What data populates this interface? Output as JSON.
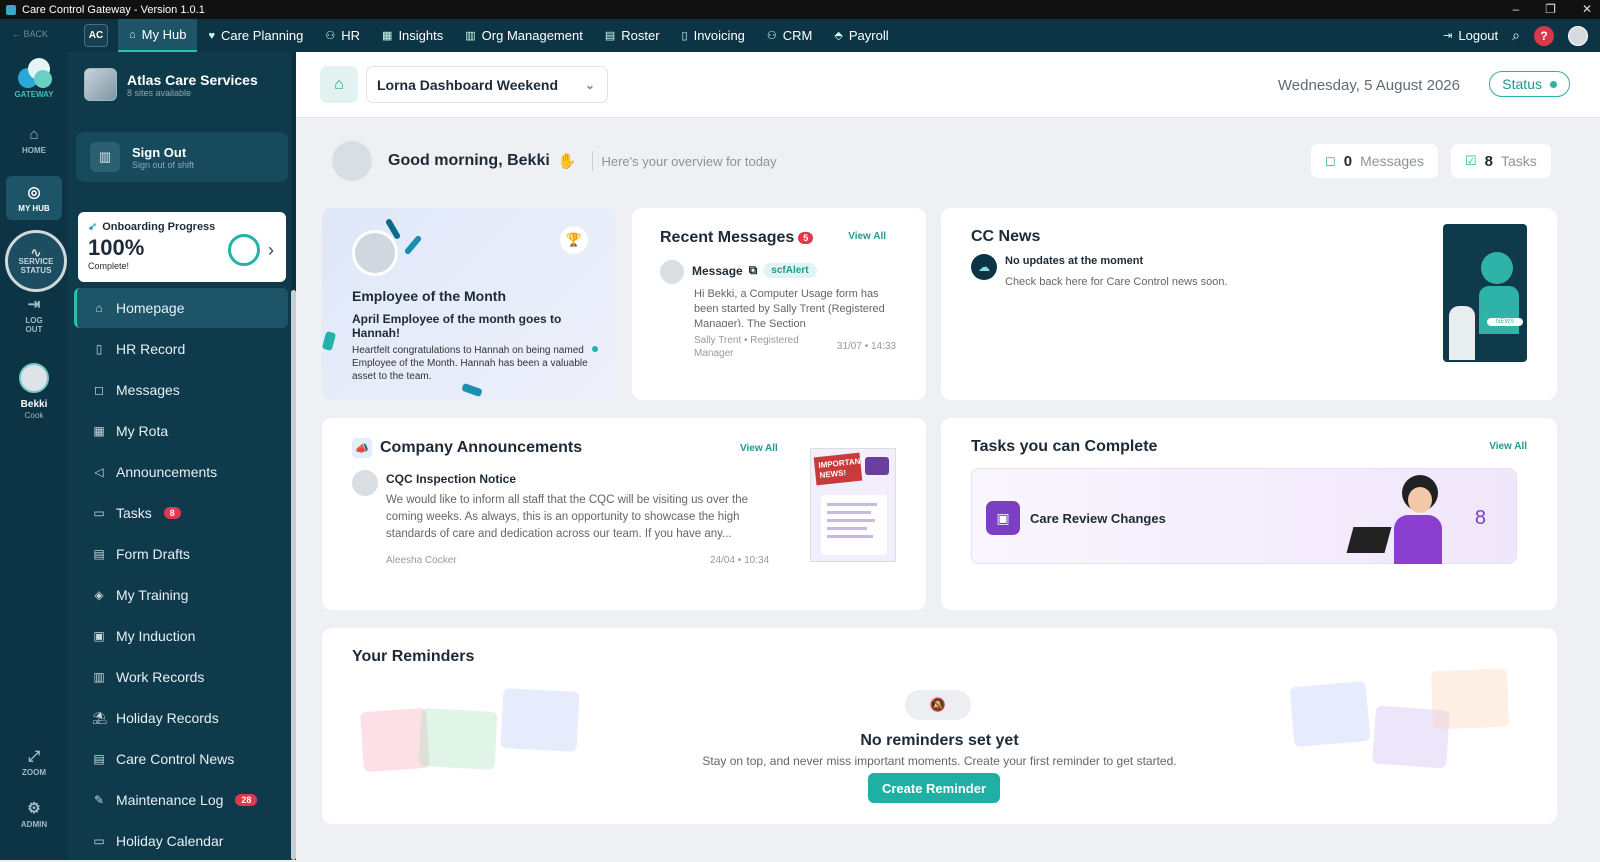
{
  "window": {
    "title": "Care Control Gateway - Version 1.0.1",
    "min": "–",
    "max": "❐",
    "close": "✕"
  },
  "topnav": {
    "back": "BACK",
    "ac": "AC",
    "items": [
      {
        "label": "My Hub",
        "icon": "⌂"
      },
      {
        "label": "Care Planning",
        "icon": "♥"
      },
      {
        "label": "HR",
        "icon": "⚇"
      },
      {
        "label": "Insights",
        "icon": "▦"
      },
      {
        "label": "Org Management",
        "icon": "▥"
      },
      {
        "label": "Roster",
        "icon": "▤"
      },
      {
        "label": "Invoicing",
        "icon": "▯"
      },
      {
        "label": "CRM",
        "icon": "⚇"
      },
      {
        "label": "Payroll",
        "icon": "⬘"
      }
    ],
    "logout": "Logout",
    "help": "?"
  },
  "rail": {
    "logo_text": "GATEWAY",
    "home": "HOME",
    "my_hub": "MY HUB",
    "service_status": "SERVICE STATUS",
    "log_out": "LOG OUT",
    "user_name": "Bekki",
    "user_role": "Cook",
    "zoom": "ZOOM",
    "admin": "ADMIN"
  },
  "sidebar": {
    "org_name": "Atlas Care Services",
    "org_sub": "8 sites available",
    "signout_title": "Sign Out",
    "signout_sub": "Sign out of shift",
    "onboarding": {
      "title": "Onboarding Progress",
      "percent": "100%",
      "sub": "Complete!",
      "progress": 1.0
    },
    "menu": [
      {
        "label": "Homepage",
        "icon": "⌂",
        "badge": ""
      },
      {
        "label": "HR Record",
        "icon": "▯",
        "badge": ""
      },
      {
        "label": "Messages",
        "icon": "◻",
        "badge": ""
      },
      {
        "label": "My Rota",
        "icon": "▦",
        "badge": ""
      },
      {
        "label": "Announcements",
        "icon": "◁",
        "badge": ""
      },
      {
        "label": "Tasks",
        "icon": "▭",
        "badge": "8"
      },
      {
        "label": "Form Drafts",
        "icon": "▤",
        "badge": ""
      },
      {
        "label": "My Training",
        "icon": "◈",
        "badge": ""
      },
      {
        "label": "My Induction",
        "icon": "▣",
        "badge": ""
      },
      {
        "label": "Work Records",
        "icon": "▥",
        "badge": ""
      },
      {
        "label": "Holiday Records",
        "icon": "⛱",
        "badge": ""
      },
      {
        "label": "Care Control News",
        "icon": "▤",
        "badge": ""
      },
      {
        "label": "Maintenance Log",
        "icon": "✎",
        "badge": "28"
      },
      {
        "label": "Holiday Calendar",
        "icon": "▭",
        "badge": ""
      }
    ]
  },
  "header": {
    "dashboard": "Lorna Dashboard Weekend",
    "date": "Wednesday, 5 August 2026",
    "status": "Status"
  },
  "greeting": {
    "text": "Good morning, Bekki",
    "sub": "Here's your overview for today",
    "messages_count": "0",
    "messages_label": "Messages",
    "tasks_count": "8",
    "tasks_label": "Tasks"
  },
  "employee": {
    "title": "Employee of the Month",
    "headline": "April Employee of the month goes to Hannah!",
    "body": "Heartfelt congratulations to Hannah on being named Employee of the Month. Hannah has been a valuable asset to the team."
  },
  "recent_messages": {
    "title": "Recent Messages",
    "badge": "5",
    "view_all": "View All",
    "msg_title": "Message",
    "tag": "scfAlert",
    "body": "Hi Bekki, a Computer Usage form has been started by Sally Trent (Registered Manager). The Section",
    "from": "Sally Trent • Registered Manager",
    "time": "31/07 • 14:33"
  },
  "cc_news": {
    "title": "CC News",
    "headline": "No updates at the moment",
    "sub": "Check back here for Care Control news soon.",
    "img_word": "NEWS"
  },
  "announcements": {
    "title": "Company Announcements",
    "view_all": "View All",
    "item_title": "CQC Inspection Notice",
    "body": "We would like to inform all staff that the CQC will be visiting us over the coming weeks. As always, this is an opportunity to showcase the high standards of care and dedication across our team. If you have any...",
    "author": "Aleesha Cocker",
    "time": "24/04 • 10:34",
    "img_text": "IMPORTANT NEWS!"
  },
  "tasks_card": {
    "title": "Tasks you can Complete",
    "view_all": "View All",
    "item": "Care Review Changes",
    "count": "8"
  },
  "reminders": {
    "title": "Your Reminders",
    "empty_title": "No reminders set yet",
    "empty_sub": "Stay on top, and never miss important moments. Create your first reminder to get started.",
    "button": "Create Reminder"
  },
  "colors": {
    "nav": "#0d3445",
    "sidebar": "#0f3a4b",
    "accent": "#1fb0a3",
    "badge": "#e2384d",
    "purple": "#7b3fc4"
  }
}
